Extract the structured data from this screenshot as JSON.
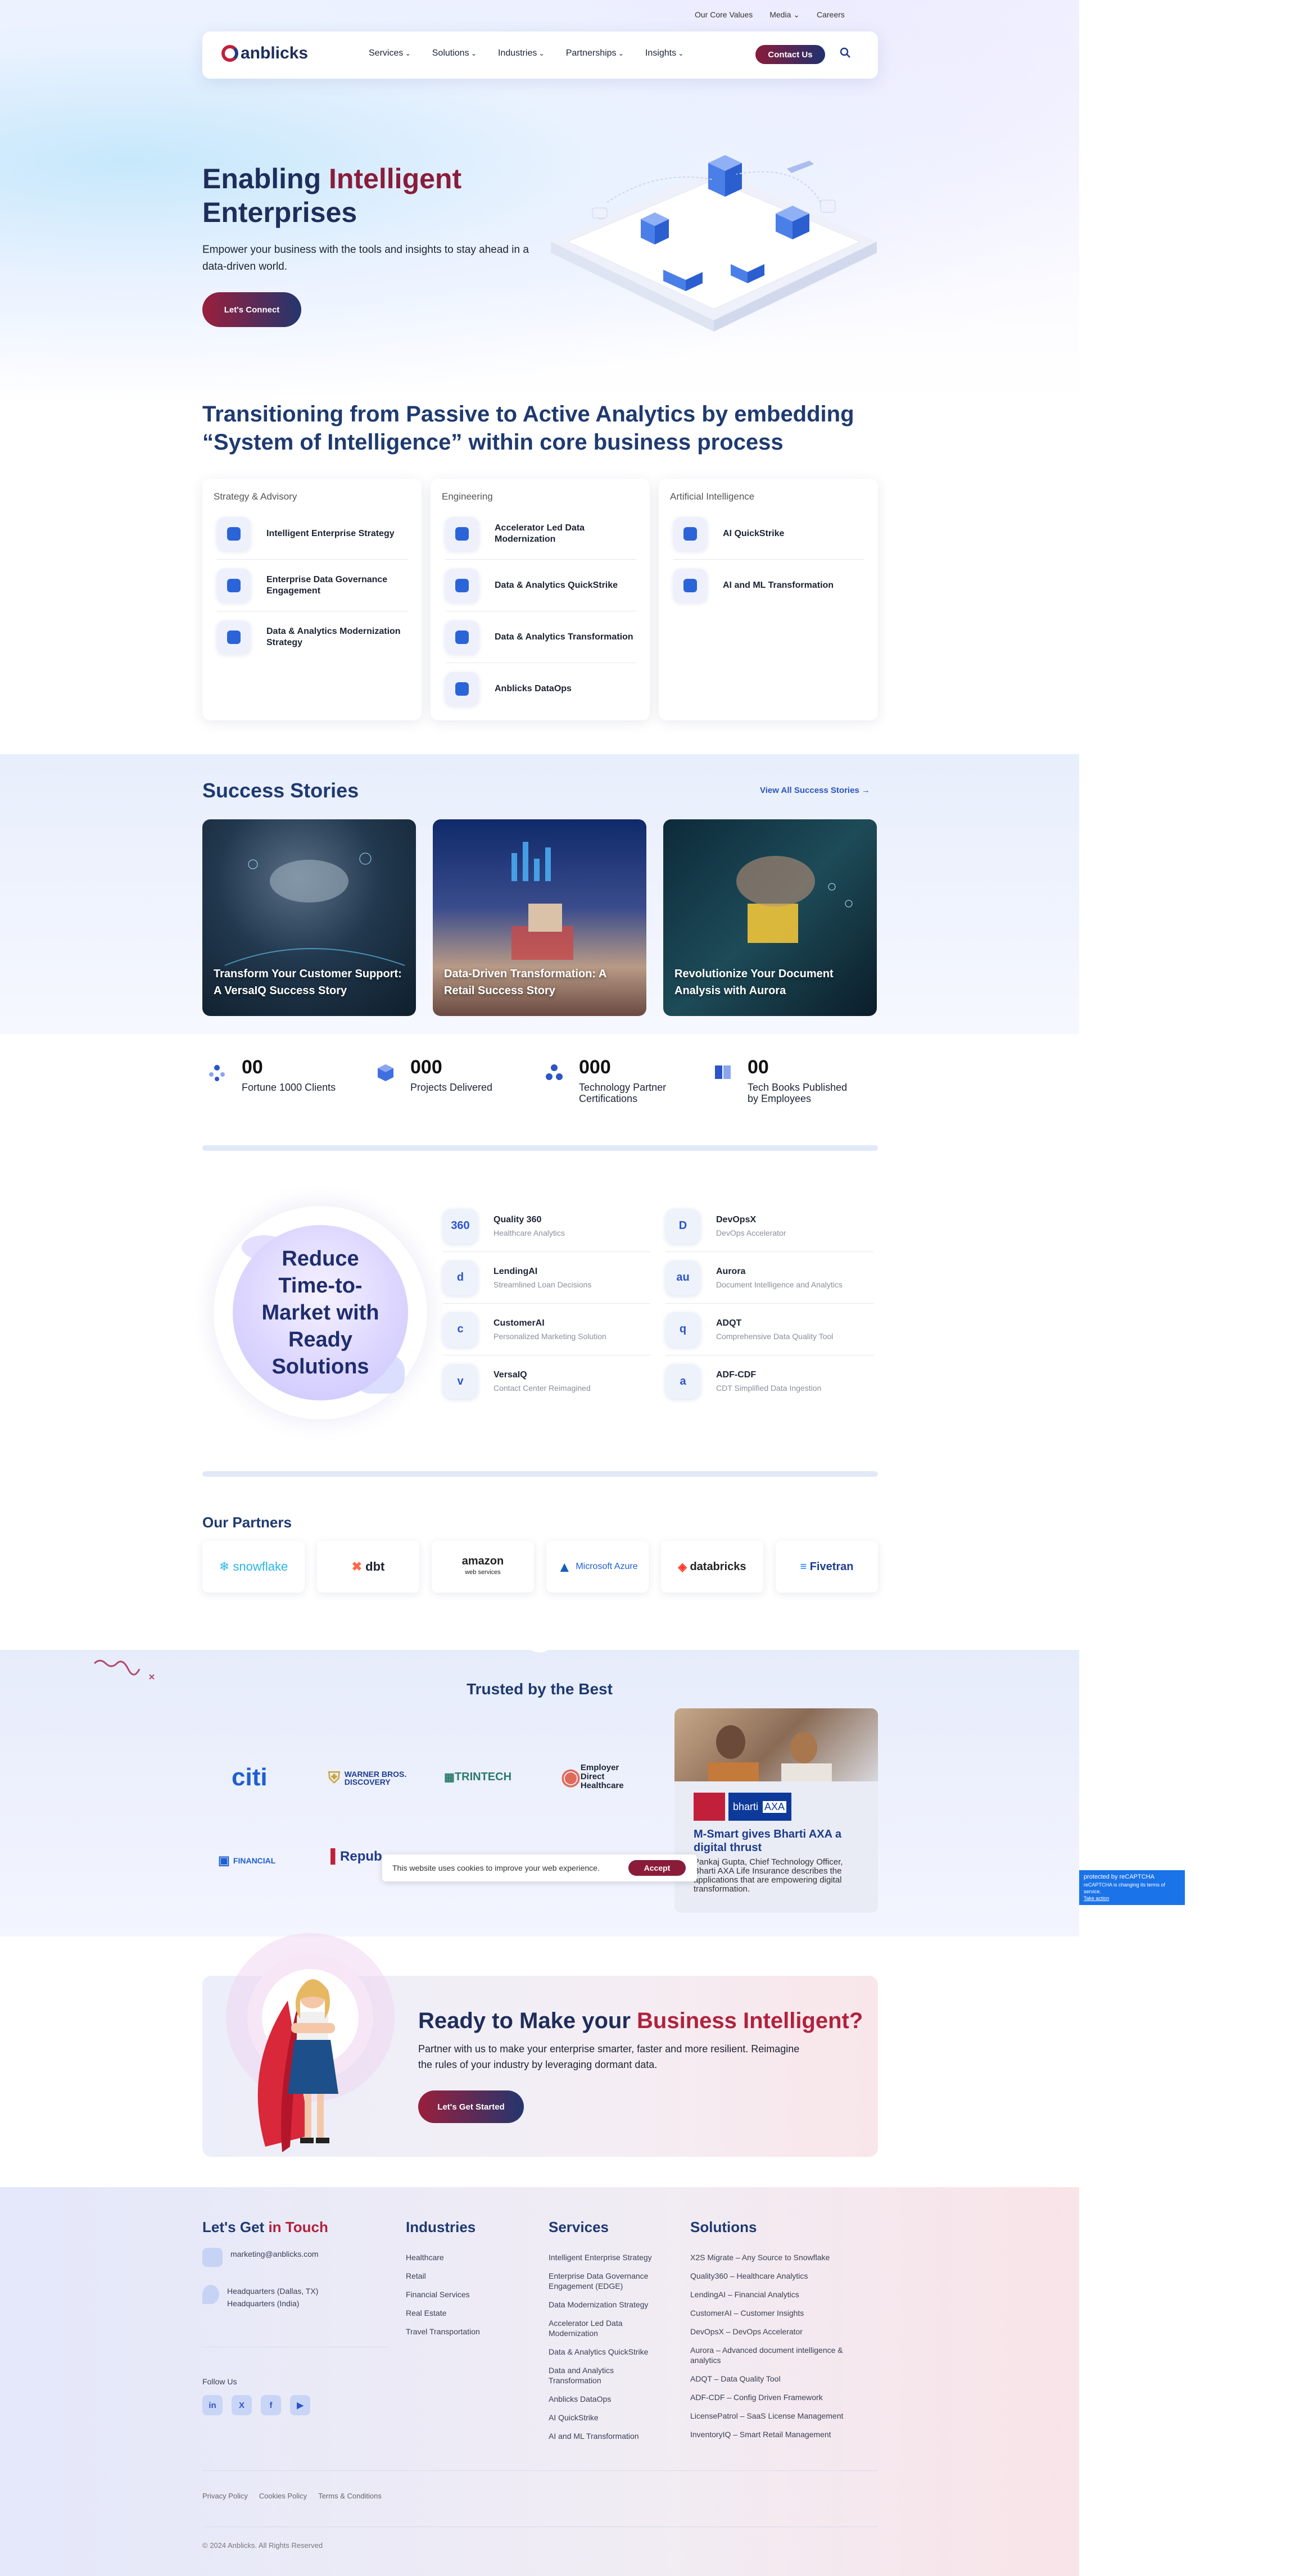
{
  "top_links": [
    "Our Core Values",
    "Media",
    "Careers"
  ],
  "nav": {
    "logo": "anblicks",
    "items": [
      "Services",
      "Solutions",
      "Industries",
      "Partnerships",
      "Insights"
    ],
    "contact": "Contact Us"
  },
  "hero": {
    "title_1": "Enabling ",
    "title_accent": "Intelligent",
    "title_2": "Enterprises",
    "subtitle": "Empower your business with the tools and insights to stay ahead in a data-driven world.",
    "button": "Let's Connect"
  },
  "transition": {
    "title": "Transitioning from Passive to Active Analytics by embedding “System of Intelligence” within core business process",
    "columns": [
      {
        "heading": "Strategy & Advisory",
        "items": [
          "Intelligent Enterprise Strategy",
          "Enterprise Data Governance Engagement",
          "Data & Analytics Modernization Strategy"
        ]
      },
      {
        "heading": "Engineering",
        "items": [
          "Accelerator Led Data Modernization",
          "Data & Analytics QuickStrike",
          "Data & Analytics Transformation",
          "Anblicks DataOps"
        ]
      },
      {
        "heading": "Artificial Intelligence",
        "items": [
          "AI QuickStrike",
          "AI and ML Transformation"
        ]
      }
    ]
  },
  "success": {
    "title": "Success Stories",
    "link": "View All Success Stories →",
    "stories": [
      "Transform Your Customer Support: A VersaIQ Success Story",
      "Data-Driven Transformation: A Retail Success Story",
      "Revolutionize Your Document Analysis with Aurora"
    ]
  },
  "stats": [
    {
      "num": "00",
      "label": "Fortune 1000 Clients"
    },
    {
      "num": "000",
      "label": "Projects Delivered"
    },
    {
      "num": "000",
      "label": "Technology Partner Certifications"
    },
    {
      "num": "00",
      "label": "Tech Books Published by Employees"
    }
  ],
  "products": {
    "circle": "Reduce Time-to-Market with Ready Solutions",
    "items": [
      {
        "name": "Quality 360",
        "desc": "Healthcare Analytics",
        "icon": "360"
      },
      {
        "name": "DevOpsX",
        "desc": "DevOps Accelerator",
        "icon": "D"
      },
      {
        "name": "LendingAI",
        "desc": "Streamlined Loan Decisions",
        "icon": "d"
      },
      {
        "name": "Aurora",
        "desc": "Document Intelligence and Analytics",
        "icon": "au"
      },
      {
        "name": "CustomerAI",
        "desc": "Personalized Marketing Solution",
        "icon": "c"
      },
      {
        "name": "ADQT",
        "desc": "Comprehensive Data Quality Tool",
        "icon": "q"
      },
      {
        "name": "VersaIQ",
        "desc": "Contact Center Reimagined",
        "icon": "v"
      },
      {
        "name": "ADF-CDF",
        "desc": "CDT Simplified Data Ingestion",
        "icon": "a"
      }
    ]
  },
  "partners": {
    "title": "Our Partners",
    "logos": [
      "snowflake",
      "dbt",
      "amazon",
      "Microsoft Azure",
      "databricks",
      "Fivetran"
    ],
    "amazon_sub": "web services"
  },
  "trusted": {
    "title": "Trusted by the Best",
    "logos": [
      "citi",
      "WARNER BROS. DISCOVERY",
      "TRINTECH",
      "Employer Direct Healthcare",
      "FINANCIAL",
      "Repub"
    ],
    "case_title": "M-Smart gives Bharti AXA a digital thrust",
    "case_text": "Pankaj Gupta, Chief Technology Officer, Bharti AXA Life Insurance describes the applications that are empowering digital transformation.",
    "case_logo_1": "bharti",
    "case_logo_2": "AXA"
  },
  "cookie": {
    "text": "This website uses cookies to improve your web experience.",
    "button": "Accept"
  },
  "cta": {
    "title_1": "Ready to Make your ",
    "title_accent": "Business Intelligent?",
    "subtitle": "Partner with us to make your enterprise smarter, faster and more resilient. Reimagine the rules of your industry by leveraging dormant data.",
    "button": "Let's Get Started"
  },
  "footer": {
    "touch_1": "Let's Get ",
    "touch_accent": "in Touch",
    "email": "marketing@anblicks.com",
    "hq1": "Headquarters (Dallas, TX)",
    "hq2": "Headquarters (India)",
    "follow": "Follow Us",
    "social": [
      "in",
      "X",
      "f",
      "▶"
    ],
    "industries_title": "Industries",
    "industries": [
      "Healthcare",
      "Retail",
      "Financial Services",
      "Real Estate",
      "Travel Transportation"
    ],
    "services_title": "Services",
    "services": [
      "Intelligent Enterprise Strategy",
      "Enterprise Data Governance Engagement (EDGE)",
      "Data Modernization Strategy",
      "Accelerator Led Data Modernization",
      "Data & Analytics QuickStrike",
      "Data and Analytics Transformation",
      "Anblicks DataOps",
      "AI QuickStrike",
      "AI and ML Transformation"
    ],
    "solutions_title": "Solutions",
    "solutions": [
      "X2S Migrate – Any Source to Snowflake",
      "Quality360 – Healthcare Analytics",
      "LendingAI – Financial Analytics",
      "CustomerAI – Customer Insights",
      "DevOpsX – DevOps Accelerator",
      "Aurora – Advanced document intelligence & analytics",
      "ADQT – Data Quality Tool",
      "ADF-CDF – Config Driven Framework",
      "LicensePatrol – SaaS License Management",
      "InventoryIQ – Smart Retail Management"
    ],
    "legal": [
      "Privacy Policy",
      "Cookies Policy",
      "Terms & Conditions"
    ],
    "copyright": "© 2024 Anblicks. All Rights Reserved"
  },
  "recaptcha": {
    "line1": "protected by reCAPTCHA",
    "line2": "reCAPTCHA is changing its terms of service.",
    "link": "Take action"
  },
  "colors": {
    "navy": "#1e3a70",
    "crimson": "#8a1c3a",
    "blue": "#2b55c8"
  }
}
